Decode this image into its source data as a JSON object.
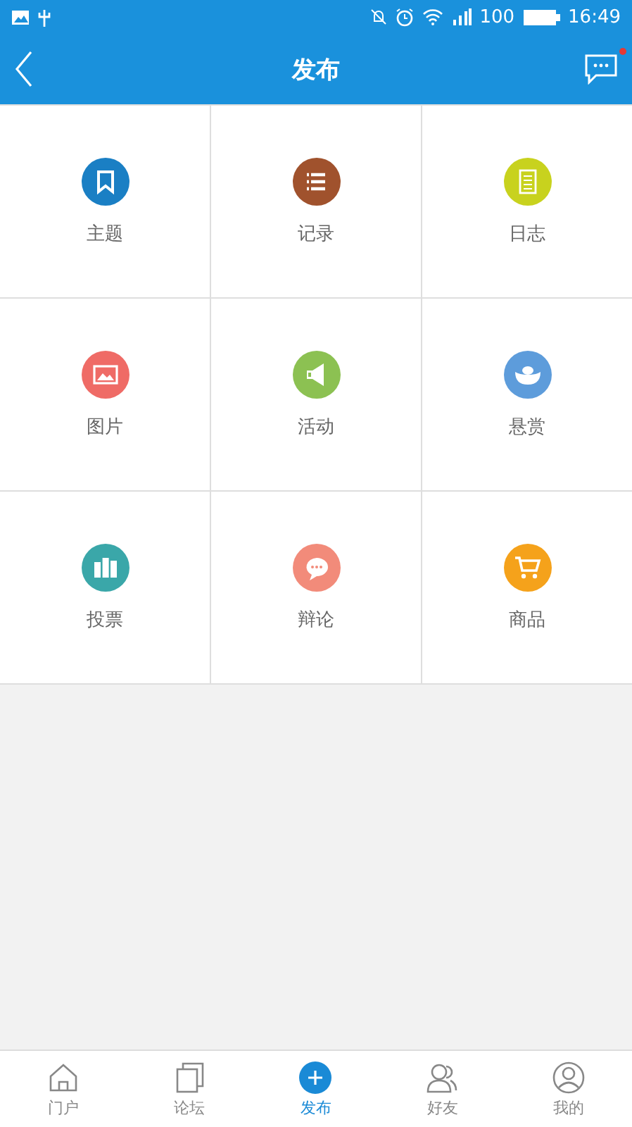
{
  "status_bar": {
    "battery": "100",
    "time": "16:49"
  },
  "header": {
    "title": "发布",
    "has_unread": true
  },
  "items": [
    {
      "label": "主题",
      "color": "#1a7fc4"
    },
    {
      "label": "记录",
      "color": "#a0522d"
    },
    {
      "label": "日志",
      "color": "#c8d21e"
    },
    {
      "label": "图片",
      "color": "#ef6b66"
    },
    {
      "label": "活动",
      "color": "#8cc152"
    },
    {
      "label": "悬赏",
      "color": "#5d9cdb"
    },
    {
      "label": "投票",
      "color": "#3aa7a9"
    },
    {
      "label": "辩论",
      "color": "#f28b7a"
    },
    {
      "label": "商品",
      "color": "#f5a21b"
    }
  ],
  "tabs": [
    {
      "label": "门户",
      "selected": false
    },
    {
      "label": "论坛",
      "selected": false
    },
    {
      "label": "发布",
      "selected": true
    },
    {
      "label": "好友",
      "selected": false
    },
    {
      "label": "我的",
      "selected": false
    }
  ]
}
